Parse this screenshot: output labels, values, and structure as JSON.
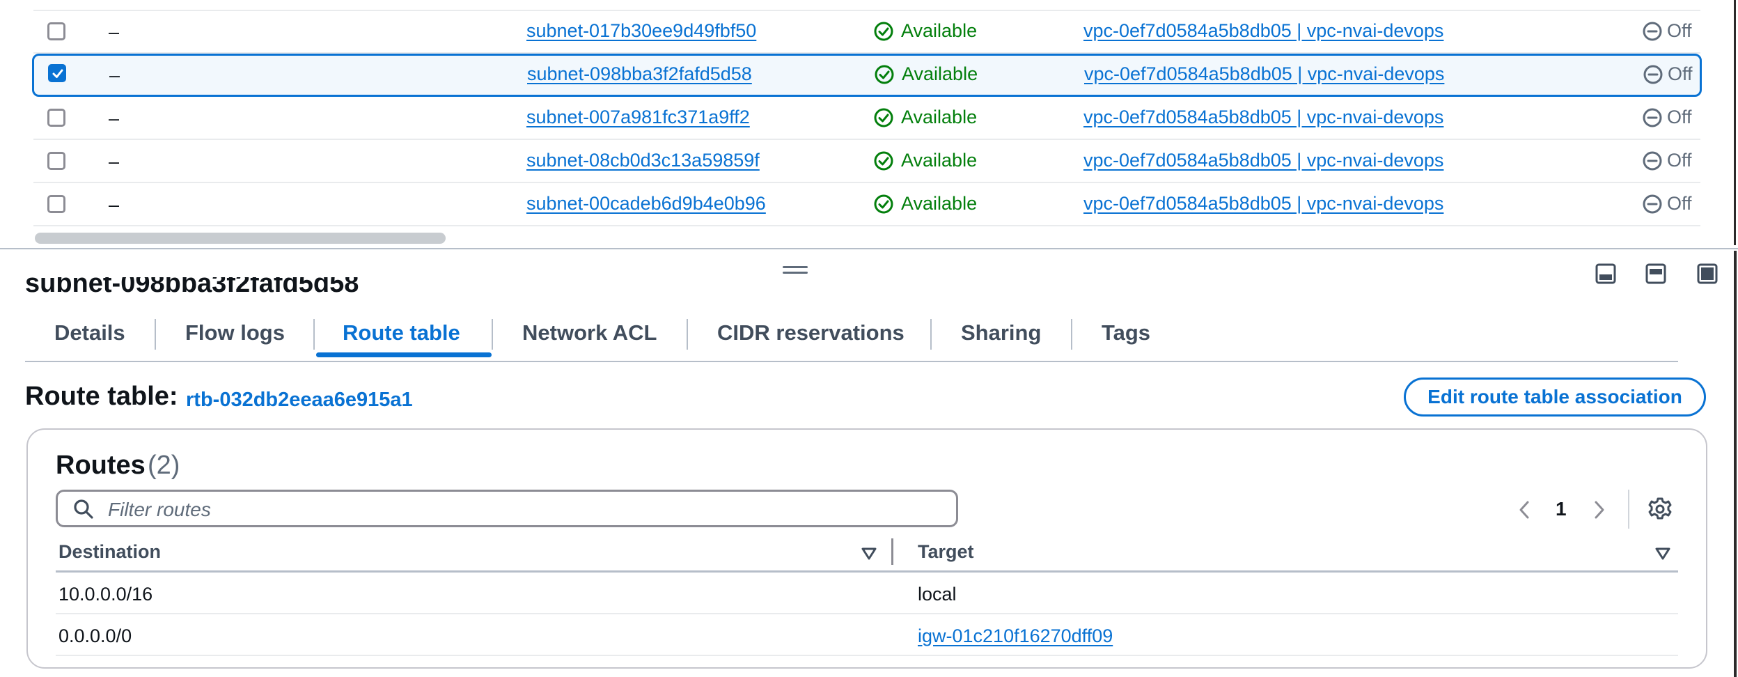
{
  "subnets": {
    "rows": [
      {
        "name": "–",
        "subnet_id": "subnet-017b30ee9d49fbf50",
        "state": "Available",
        "vpc": "vpc-0ef7d0584a5b8db05 | vpc-nvai-devops",
        "flag": "Off",
        "checked": false
      },
      {
        "name": "–",
        "subnet_id": "subnet-098bba3f2fafd5d58",
        "state": "Available",
        "vpc": "vpc-0ef7d0584a5b8db05 | vpc-nvai-devops",
        "flag": "Off",
        "checked": true
      },
      {
        "name": "–",
        "subnet_id": "subnet-007a981fc371a9ff2",
        "state": "Available",
        "vpc": "vpc-0ef7d0584a5b8db05 | vpc-nvai-devops",
        "flag": "Off",
        "checked": false
      },
      {
        "name": "–",
        "subnet_id": "subnet-08cb0d3c13a59859f",
        "state": "Available",
        "vpc": "vpc-0ef7d0584a5b8db05 | vpc-nvai-devops",
        "flag": "Off",
        "checked": false
      },
      {
        "name": "–",
        "subnet_id": "subnet-00cadeb6d9b4e0b96",
        "state": "Available",
        "vpc": "vpc-0ef7d0584a5b8db05 | vpc-nvai-devops",
        "flag": "Off",
        "checked": false
      }
    ]
  },
  "details": {
    "heading": "subnet-098bba3f2fafd5d58",
    "tabs": [
      "Details",
      "Flow logs",
      "Route table",
      "Network ACL",
      "CIDR reservations",
      "Sharing",
      "Tags"
    ],
    "active_tab": "Route table",
    "route_table_label": "Route table:",
    "route_table_id": "rtb-032db2eeaa6e915a1",
    "edit_button": "Edit route table association"
  },
  "routes": {
    "title": "Routes",
    "count": "(2)",
    "filter_placeholder": "Filter routes",
    "page": "1",
    "columns": [
      "Destination",
      "Target"
    ],
    "rows": [
      {
        "destination": "10.0.0.0/16",
        "target": "local",
        "target_is_link": false
      },
      {
        "destination": "0.0.0.0/0",
        "target": "igw-01c210f16270dff09",
        "target_is_link": true
      }
    ]
  },
  "colors": {
    "link": "#0972d3",
    "available": "#037f0c",
    "muted": "#5f6b7a"
  },
  "icons": [
    "checkbox-icon",
    "status-available-icon",
    "status-off-icon",
    "drag-handle-icon",
    "split-bottom-icon",
    "split-side-icon",
    "fullscreen-icon",
    "search-icon",
    "chevron-left-icon",
    "chevron-right-icon",
    "settings-gear-icon",
    "sort-caret-icon"
  ]
}
